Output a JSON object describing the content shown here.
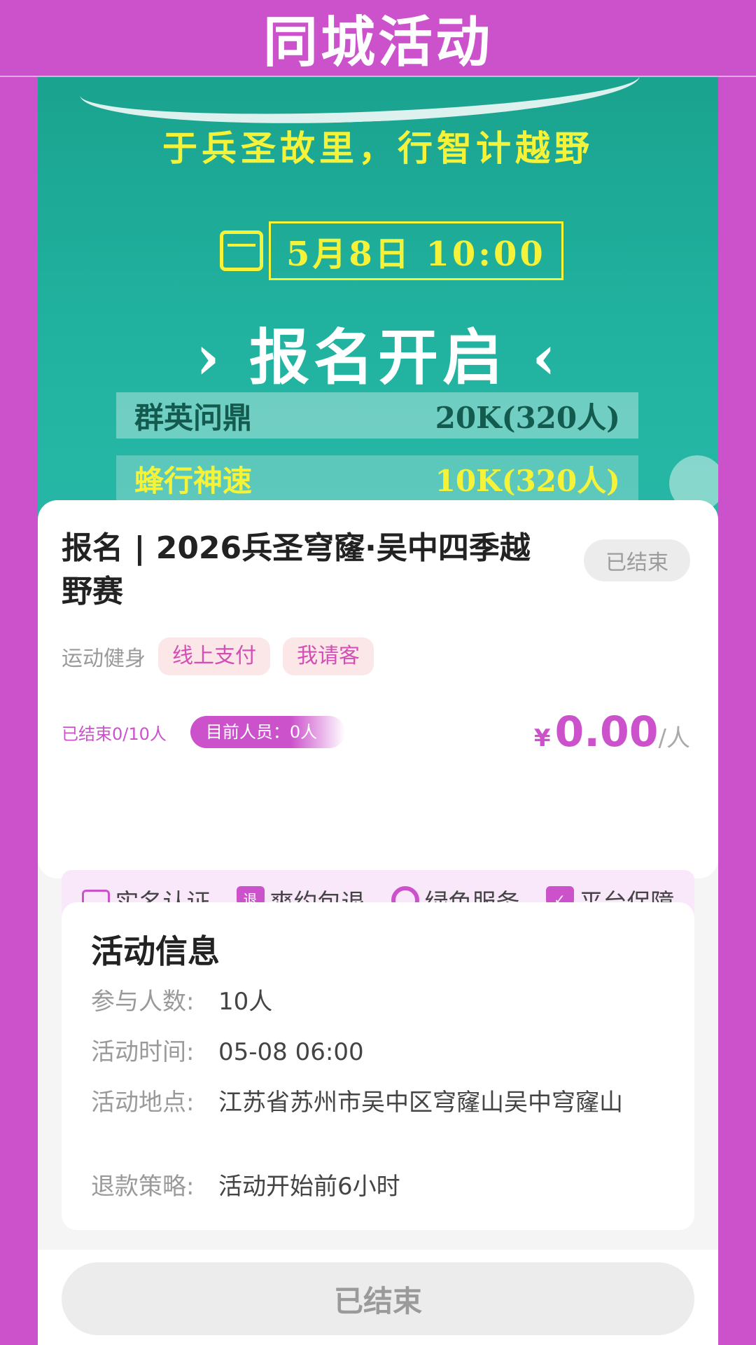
{
  "header": {
    "title": "同城活动"
  },
  "banner": {
    "slogan": "于兵圣故里，行智计越野",
    "date": "5月8日 10:00",
    "registration": "› 报名开启 ‹",
    "rows": [
      {
        "name": "群英问鼎",
        "detail": "20K(320人)"
      },
      {
        "name": "蜂行神速",
        "detail": "10K(320人)"
      }
    ]
  },
  "event": {
    "title": "报名 | 2026兵圣穹窿·吴中四季越野赛",
    "status_badge": "已结束",
    "category": "运动健身",
    "tags": [
      "线上支付",
      "我请客"
    ],
    "enroll_status": "已结束0/10人",
    "current_members": "目前人员：0人",
    "price": {
      "currency": "¥",
      "amount": "0.00",
      "unit": "/人"
    },
    "guarantees": [
      "实名认证",
      "爽约包退",
      "绿色服务",
      "平台保障"
    ]
  },
  "info": {
    "heading": "活动信息",
    "rows": [
      {
        "label": "参与人数:",
        "value": "10人"
      },
      {
        "label": "活动时间:",
        "value": "05-08 06:00"
      },
      {
        "label": "活动地点:",
        "value": "江苏省苏州市吴中区穹窿山吴中穹窿山"
      },
      {
        "label": "退款策略:",
        "value": "活动开始前6小时"
      }
    ]
  },
  "footer": {
    "button_label": "已结束"
  },
  "colors": {
    "accent": "#cc52cc",
    "banner": "#21b3a0",
    "slogan": "#f4f33a"
  }
}
